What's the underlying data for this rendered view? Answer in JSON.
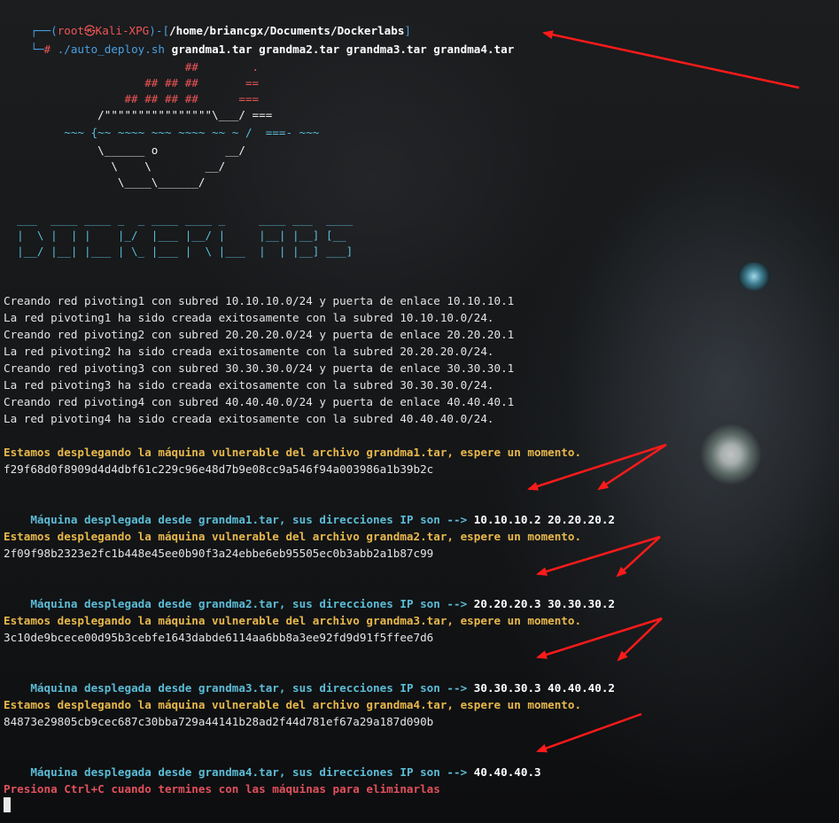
{
  "prompt": {
    "open": "┌──(",
    "user": "root㉿Kali-XPG",
    "mid": ")-[",
    "path": "/home/briancgx/Documents/Dockerlabs",
    "close": "]",
    "corner": "└─",
    "hash": "# ",
    "command": "./auto_deploy.sh",
    "args": "grandma1.tar grandma2.tar grandma3.tar grandma4.tar"
  },
  "ascii_whale": [
    "                           ##        .",
    "                     ## ## ##       ==",
    "                  ## ## ## ##      ===",
    "              /\"\"\"\"\"\"\"\"\"\"\"\"\"\"\"\"\\___/ ===",
    "         ~~~ {~~ ~~~~ ~~~ ~~~~ ~~ ~ /  ===- ~~~",
    "              \\______ o          __/",
    "                \\    \\        __/",
    "                 \\____\\______/"
  ],
  "ascii_logo": [
    "  ___  ____ ____ _  _ ____ ____ _     ____ ___  ____",
    "  |  \\ |  | |    |_/  |___ |__/ |     |__| |__] [__",
    "  |__/ |__| |___ | \\_ |___ |  \\ |___  |  | |__] ___]"
  ],
  "network_lines": [
    "Creando red pivoting1 con subred 10.10.10.0/24 y puerta de enlace 10.10.10.1",
    "La red pivoting1 ha sido creada exitosamente con la subred 10.10.10.0/24.",
    "Creando red pivoting2 con subred 20.20.20.0/24 y puerta de enlace 20.20.20.1",
    "La red pivoting2 ha sido creada exitosamente con la subred 20.20.20.0/24.",
    "Creando red pivoting3 con subred 30.30.30.0/24 y puerta de enlace 30.30.30.1",
    "La red pivoting3 ha sido creada exitosamente con la subred 30.30.30.0/24.",
    "Creando red pivoting4 con subred 40.40.40.0/24 y puerta de enlace 40.40.40.1",
    "La red pivoting4 ha sido creada exitosamente con la subred 40.40.40.0/24."
  ],
  "deployments": [
    {
      "status": "Estamos desplegando la máquina vulnerable del archivo grandma1.tar, espere un momento.",
      "hash": "f29f68d0f8909d4d4dbf61c229c96e48d7b9e08cc9a546f94a003986a1b39b2c",
      "result_label": "Máquina desplegada desde grandma1.tar, sus direcciones IP son -->",
      "ips": "10.10.10.2 20.20.20.2"
    },
    {
      "status": "Estamos desplegando la máquina vulnerable del archivo grandma2.tar, espere un momento.",
      "hash": "2f09f98b2323e2fc1b448e45ee0b90f3a24ebbe6eb95505ec0b3abb2a1b87c99",
      "result_label": "Máquina desplegada desde grandma2.tar, sus direcciones IP son -->",
      "ips": "20.20.20.3 30.30.30.2"
    },
    {
      "status": "Estamos desplegando la máquina vulnerable del archivo grandma3.tar, espere un momento.",
      "hash": "3c10de9bcece00d95b3cebfe1643dabde6114aa6bb8a3ee92fd9d91f5ffee7d6",
      "result_label": "Máquina desplegada desde grandma3.tar, sus direcciones IP son -->",
      "ips": "30.30.30.3 40.40.40.2"
    },
    {
      "status": "Estamos desplegando la máquina vulnerable del archivo grandma4.tar, espere un momento.",
      "hash": "84873e29805cb9cec687c30bba729a44141b28ad2f44d781ef67a29a187d090b",
      "result_label": "Máquina desplegada desde grandma4.tar, sus direcciones IP son -->",
      "ips": "40.40.40.3"
    }
  ],
  "final_message": "Presiona Ctrl+C cuando termines con las máquinas para eliminarlas",
  "colors": {
    "prompt_frame": "#4a9fe0",
    "prompt_user": "#ef5555",
    "status_yellow": "#e8b84b",
    "result_cyan": "#5bbcd6",
    "final_red": "#e0505c",
    "annotation_arrow": "#ff1a1a"
  }
}
